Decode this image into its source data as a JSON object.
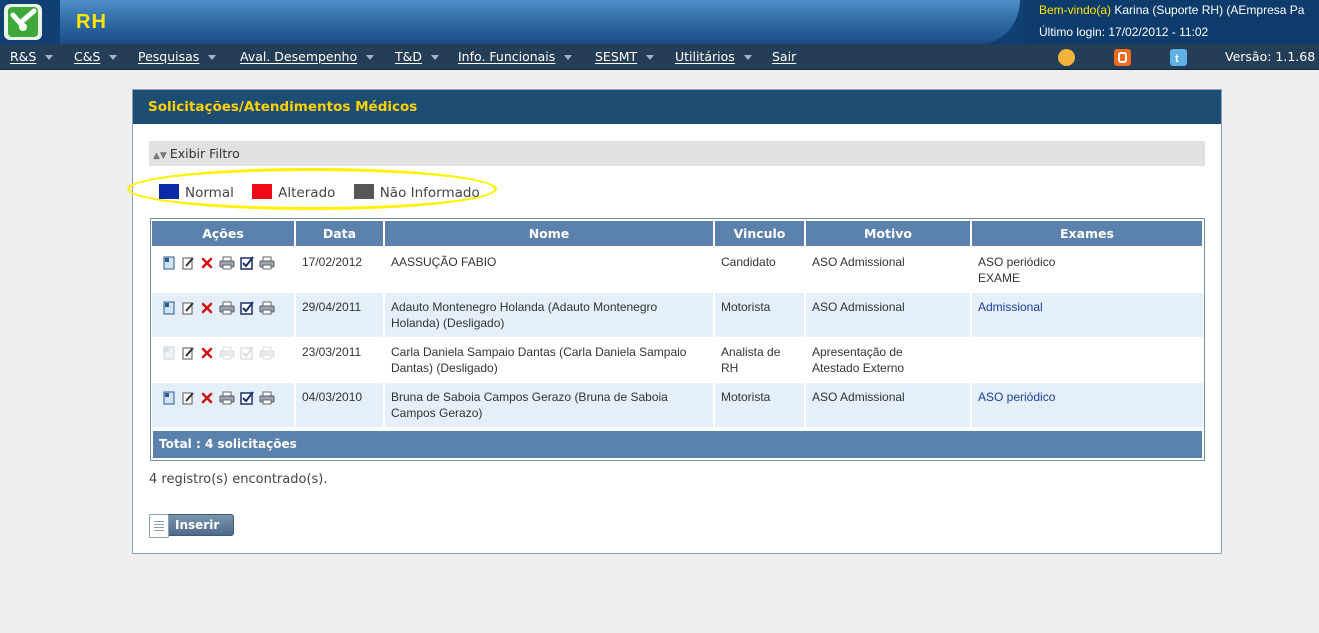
{
  "header": {
    "app_title": "RH",
    "welcome_prefix": "Bem-vindo(a)",
    "welcome_user": " Karina (Suporte RH) (AEmpresa Pa",
    "last_login": "Último login: 17/02/2012 - 11:02",
    "logo_icon": "check-person-icon"
  },
  "menu": {
    "items": [
      {
        "label": "R&S",
        "has_arrow": true
      },
      {
        "label": "C&S",
        "has_arrow": true
      },
      {
        "label": "Pesquisas",
        "has_arrow": true
      },
      {
        "label": "Aval. Desempenho",
        "has_arrow": true
      },
      {
        "label": "T&D",
        "has_arrow": true
      },
      {
        "label": "Info. Funcionais",
        "has_arrow": true
      },
      {
        "label": "SESMT",
        "has_arrow": true
      },
      {
        "label": "Utilitários",
        "has_arrow": true
      },
      {
        "label": "Sair",
        "has_arrow": false
      }
    ],
    "icons": [
      "help-icon",
      "blogger-icon",
      "twitter-icon"
    ],
    "version": "Versão: 1.1.68"
  },
  "panel": {
    "title": "Solicitações/Atendimentos Médicos",
    "filter_label": "Exibir Filtro",
    "legend": [
      {
        "label": "Normal",
        "color": "#0a2aa8"
      },
      {
        "label": "Alterado",
        "color": "#ee0a16"
      },
      {
        "label": "Não Informado",
        "color": "#575757"
      }
    ]
  },
  "table": {
    "headers": [
      "Ações",
      "Data",
      "Nome",
      "Vinculo",
      "Motivo",
      "Exames"
    ],
    "rows": [
      {
        "date": "17/02/2012",
        "name_l1": "AASSUÇÃO FABIO",
        "name_l2": "",
        "vinculo_l1": "Candidato",
        "vinculo_l2": "",
        "motivo_l1": "ASO Admissional",
        "motivo_l2": "",
        "exames_l1": "ASO periódico",
        "exames_l2": "EXAME",
        "exames_link": false,
        "icons_enabled": true
      },
      {
        "date": "29/04/2011",
        "name_l1": "Adauto Montenegro Holanda (Adauto Montenegro",
        "name_l2": "Holanda) (Desligado)",
        "vinculo_l1": "Motorista",
        "vinculo_l2": "",
        "motivo_l1": "ASO Admissional",
        "motivo_l2": "",
        "exames_l1": "Admissional",
        "exames_l2": "",
        "exames_link": true,
        "icons_enabled": true
      },
      {
        "date": "23/03/2011",
        "name_l1": "Carla Daniela Sampaio Dantas (Carla Daniela Sampaio",
        "name_l2": "Dantas) (Desligado)",
        "vinculo_l1": "Analista de",
        "vinculo_l2": "RH",
        "motivo_l1": "Apresentação de",
        "motivo_l2": "Atestado Externo",
        "exames_l1": "",
        "exames_l2": "",
        "exames_link": false,
        "icons_enabled": false
      },
      {
        "date": "04/03/2010",
        "name_l1": "Bruna de Saboia Campos Gerazo (Bruna de Saboia",
        "name_l2": "Campos Gerazo)",
        "vinculo_l1": "Motorista",
        "vinculo_l2": "",
        "motivo_l1": "ASO Admissional",
        "motivo_l2": "",
        "exames_l1": "ASO periódico",
        "exames_l2": "",
        "exames_link": true,
        "icons_enabled": true
      }
    ],
    "row_icons": [
      "view-icon",
      "edit-icon",
      "delete-icon",
      "print-icon",
      "checkbox-icon",
      "print-icon"
    ],
    "total": "Total : 4 solicitações"
  },
  "footer": {
    "records": "4 registro(s) encontrado(s).",
    "insert_label": "Inserir"
  }
}
